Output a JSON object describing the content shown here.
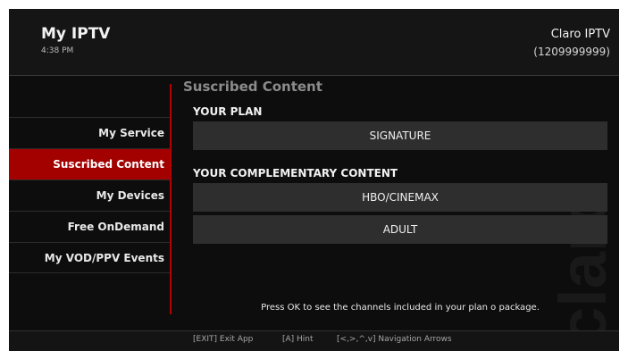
{
  "header": {
    "app_title": "My IPTV",
    "time": "4:38 PM",
    "operator": "Claro IPTV",
    "account": "(1209999999)"
  },
  "menu": {
    "items": [
      {
        "label": "My Service",
        "active": false
      },
      {
        "label": "Suscribed Content",
        "active": true
      },
      {
        "label": "My Devices",
        "active": false
      },
      {
        "label": "Free OnDemand",
        "active": false
      },
      {
        "label": "My VOD/PPV Events",
        "active": false
      }
    ]
  },
  "content": {
    "section_title": "Suscribed Content",
    "plan_heading": "YOUR PLAN",
    "plan_value": "SIGNATURE",
    "complementary_heading": "YOUR COMPLEMENTARY CONTENT",
    "complementary_items": [
      "HBO/CINEMAX",
      "ADULT"
    ],
    "hint": "Press OK to see the channels included in your plan o package."
  },
  "footer": {
    "exit": "[EXIT] Exit App",
    "hint_key": "[A] Hint",
    "navigation": "[<,>,^,v] Navigation Arrows"
  },
  "watermark": "claro",
  "colors": {
    "accent": "#a30000",
    "divider": "#b00000",
    "background": "#0d0d0d",
    "box": "#2e2e2e"
  }
}
